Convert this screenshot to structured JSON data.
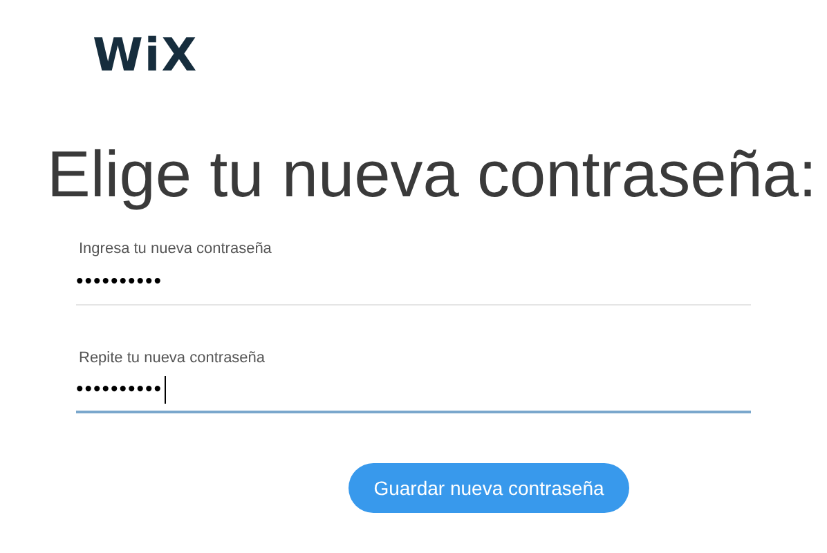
{
  "logo": "WiX",
  "title": "Elige tu nueva contraseña:",
  "fields": [
    {
      "label": "Ingresa tu nueva contraseña",
      "value": "••••••••••",
      "focused": false
    },
    {
      "label": "Repite tu nueva contraseña",
      "value": "••••••••••",
      "focused": true
    }
  ],
  "button": "Guardar nueva contraseña"
}
